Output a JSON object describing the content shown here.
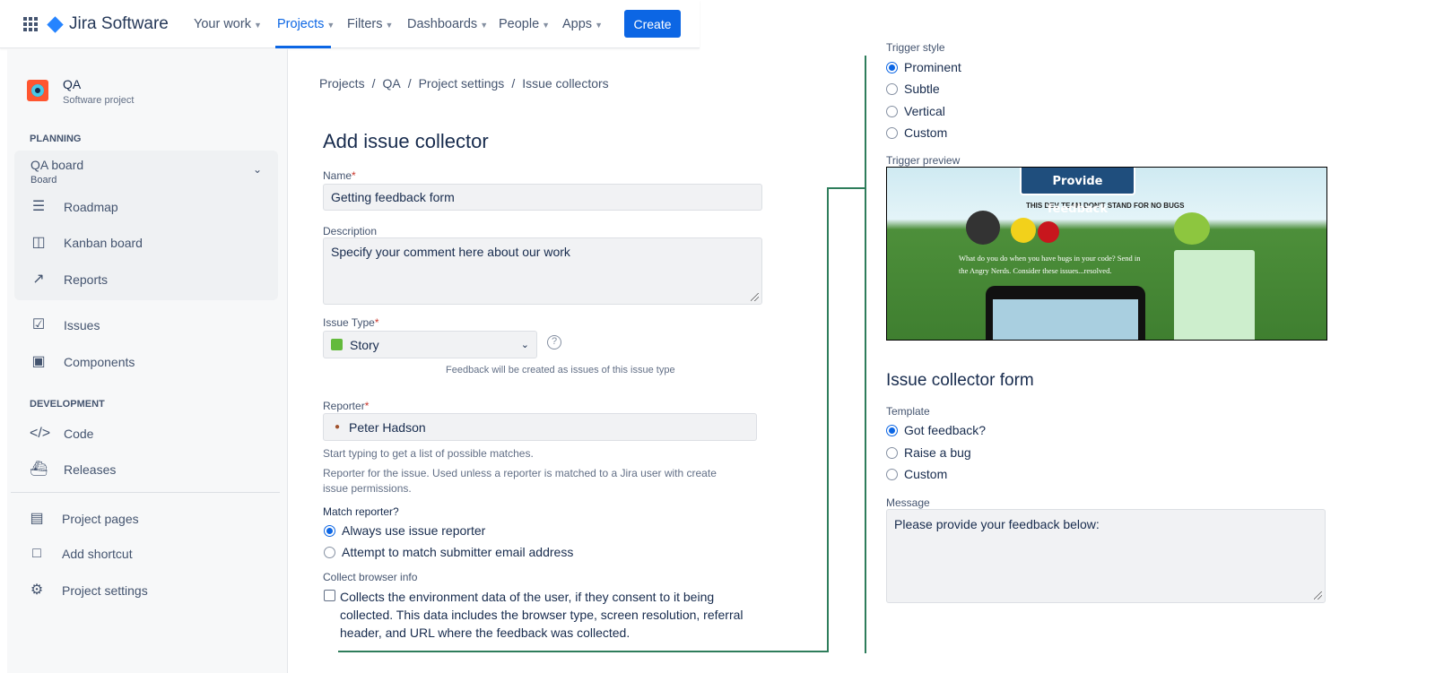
{
  "nav": {
    "product": "Jira Software",
    "items": [
      "Your work",
      "Projects",
      "Filters",
      "Dashboards",
      "People",
      "Apps"
    ],
    "active": "Projects",
    "create": "Create"
  },
  "project": {
    "name": "QA",
    "type": "Software project"
  },
  "sidebar": {
    "planning": "PLANNING",
    "board_name": "QA board",
    "board_sub": "Board",
    "board_items": [
      "Roadmap",
      "Kanban board",
      "Reports"
    ],
    "items": [
      "Issues",
      "Components"
    ],
    "development": "DEVELOPMENT",
    "dev_items": [
      "Code",
      "Releases"
    ],
    "footer": [
      "Project pages",
      "Add shortcut",
      "Project settings"
    ]
  },
  "breadcrumb": [
    "Projects",
    "QA",
    "Project settings",
    "Issue collectors"
  ],
  "form": {
    "title": "Add issue collector",
    "name_label": "Name",
    "name_value": "Getting feedback form",
    "desc_label": "Description",
    "desc_value": "Specify your comment here about our work",
    "issue_type_label": "Issue Type",
    "issue_type_value": "Story",
    "issue_type_help": "Feedback will be created as issues of this issue type",
    "reporter_label": "Reporter",
    "reporter_value": "Peter Hadson",
    "reporter_help1": "Start typing to get a list of possible matches.",
    "reporter_help2": "Reporter for the issue. Used unless a reporter is matched to a Jira user with create issue permissions.",
    "match_label": "Match reporter?",
    "match_options": [
      "Always use issue reporter",
      "Attempt to match submitter email address"
    ],
    "match_selected": 0,
    "browser_label": "Collect browser info",
    "browser_text": "Collects the environment data of the user, if they consent to it being collected. This data includes the browser type, screen resolution, referral header, and URL where the feedback was collected.",
    "browser_checked": false
  },
  "trigger": {
    "style_label": "Trigger style",
    "options": [
      "Prominent",
      "Subtle",
      "Vertical",
      "Custom"
    ],
    "selected": 0,
    "preview_label": "Trigger preview",
    "button": "Provide feedback",
    "preview_tagline": "THIS DEV TEAM DON'T STAND FOR NO BUGS",
    "preview_text": "What do you do when you have bugs in your code? Send in the Angry Nerds. Consider these issues...resolved."
  },
  "collector_form": {
    "title": "Issue collector form",
    "template_label": "Template",
    "templates": [
      "Got feedback?",
      "Raise a bug",
      "Custom"
    ],
    "selected": 0,
    "message_label": "Message",
    "message_value": "Please provide your feedback below:"
  },
  "colors": {
    "accent": "#0c66e4",
    "annotation": "#2e7d5b"
  }
}
